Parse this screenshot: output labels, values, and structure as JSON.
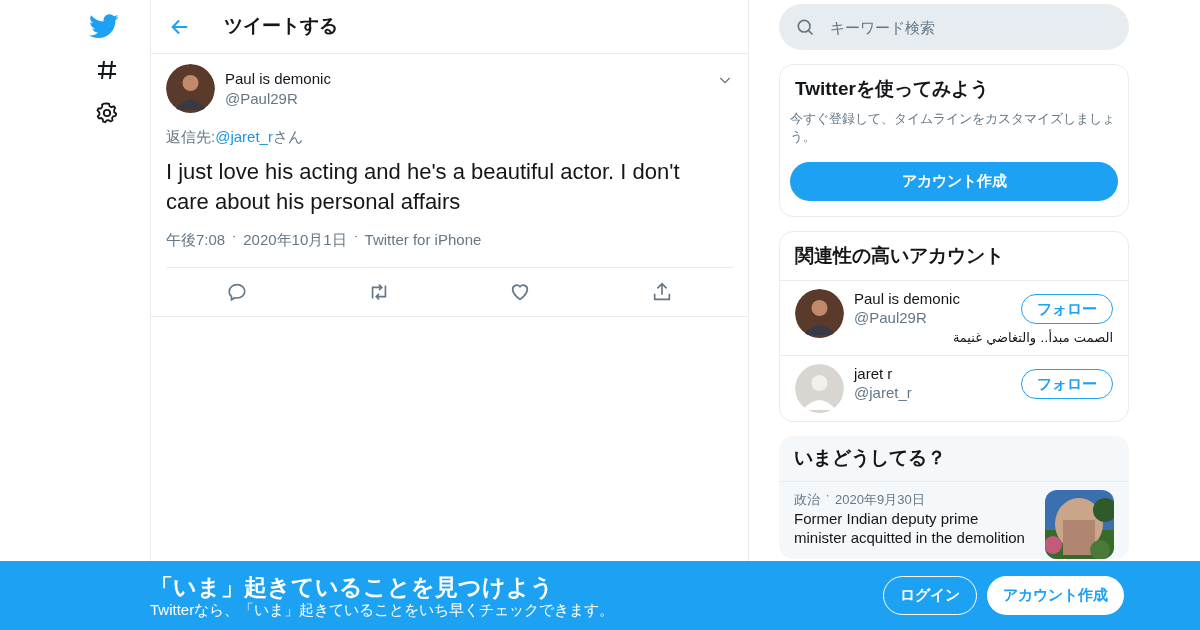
{
  "header": {
    "title": "ツイートする"
  },
  "tweet": {
    "name": "Paul is demonic",
    "handle": "@Paul29R",
    "reply_prefix": "返信先: ",
    "reply_to": "@jaret_r",
    "reply_suffix": "さん",
    "text": "I just love his acting and he's a beautiful actor. I don't care about his personal affairs",
    "time": "午後7:08",
    "separator": "・",
    "date": "2020年10月1日",
    "source": "Twitter for iPhone"
  },
  "search": {
    "placeholder": "キーワード検索"
  },
  "signup_card": {
    "title": "Twitterを使ってみよう",
    "description": "今すぐ登録して、タイムラインをカスタマイズしましょう。",
    "button": "アカウント作成"
  },
  "related": {
    "title": "関連性の高いアカウント",
    "accounts": [
      {
        "name": "Paul is demonic",
        "handle": "@Paul29R",
        "bio": "الصمت مبدأ.. والتغاضي غنيمة",
        "button": "フォロー"
      },
      {
        "name": "jaret r",
        "handle": "@jaret_r",
        "button": "フォロー"
      }
    ]
  },
  "trends": {
    "title": "いまどうしてる？",
    "items": [
      {
        "category": "政治",
        "separator": "・",
        "date": "2020年9月30日",
        "headline": "Former Indian deputy prime minister acquitted in the demolition"
      }
    ]
  },
  "banner": {
    "title": "「いま」起きていることを見つけよう",
    "subtitle": "Twitterなら、「いま」起きていることをいち早くチェックできます。",
    "login": "ログイン",
    "signup": "アカウント作成"
  }
}
